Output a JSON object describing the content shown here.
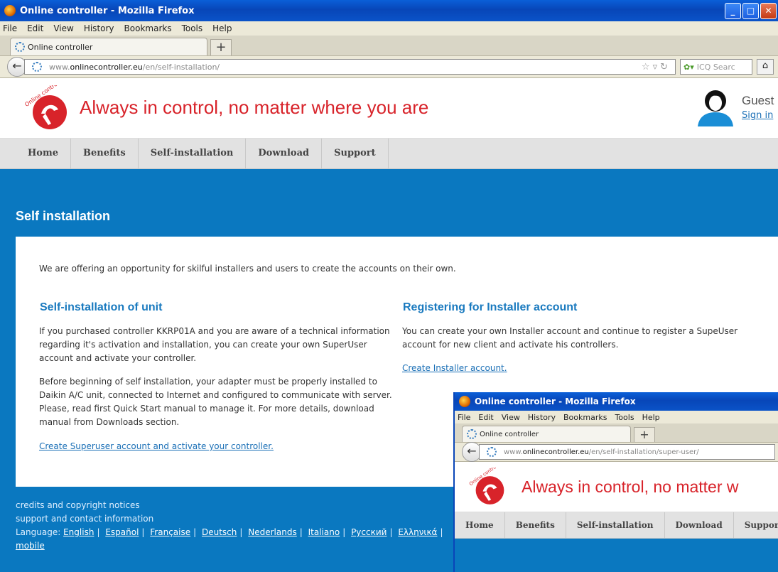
{
  "window": {
    "title": "Online controller - Mozilla Firefox",
    "menu": [
      "File",
      "Edit",
      "View",
      "History",
      "Bookmarks",
      "Tools",
      "Help"
    ],
    "tab_label": "Online controller",
    "url_prefix": "www.",
    "url_domain": "onlinecontroller.eu",
    "url_path": "/en/self-installation/",
    "search_placeholder": "ICQ Searc"
  },
  "header": {
    "logo_text": "Online controller",
    "slogan": "Always in control, no matter where you are",
    "user_name": "Guest",
    "sign_in": "Sign in"
  },
  "nav": [
    "Home",
    "Benefits",
    "Self-installation",
    "Download",
    "Support"
  ],
  "page_title": "Self installation",
  "intro": "We are offering an opportunity for skilful installers and users to create the accounts on their own.",
  "left": {
    "heading": "Self-installation of unit",
    "para1": "If you purchased controller KKRP01A and you are aware of a technical information regarding it's activation and installation, you can create your own SuperUser account and activate your controller.",
    "para2": "Before beginning of self installation, your adapter must be properly installed to Daikin A/C unit, connected to Internet and configured to communicate with server. Please, read first Quick Start manual to manage it. For more details, download manual from Downloads section.",
    "link": "Create Superuser account and activate your controller",
    "link_suffix": "."
  },
  "right": {
    "heading": "Registering for Installer account",
    "para1": "You can create your own Installer account and continue to register a SupeUser account for new client and activate his controllers.",
    "link": "Create Installer account",
    "link_suffix": "."
  },
  "footer": {
    "credits": "credits and copyright notices",
    "support": "support and contact information",
    "language_label": "Language:",
    "languages": [
      "English",
      "Español",
      "Française",
      "Deutsch",
      "Nederlands",
      "Italiano",
      "Русский",
      "Ελληνικά"
    ],
    "mobile": "mobile"
  },
  "second_window": {
    "title": "Online controller - Mozilla Firefox",
    "tab_label": "Online controller",
    "url_prefix": "www.",
    "url_domain": "onlinecontroller.eu",
    "url_path": "/en/self-installation/super-user/",
    "slogan": "Always in control, no matter w"
  },
  "colors": {
    "brand_red": "#d8232a",
    "brand_blue": "#0a78c0",
    "link_blue": "#1a6fb6"
  }
}
